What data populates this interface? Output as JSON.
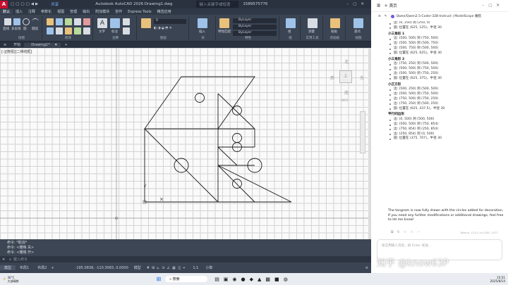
{
  "window": {
    "title": "Autodesk AutoCAD 2026    Drawing1.dwg",
    "share": "共享",
    "search_placeholder": "键入关键字或短语",
    "user": "1589575776"
  },
  "menu": [
    "默认",
    "插入",
    "注释",
    "参数化",
    "视图",
    "管理",
    "输出",
    "附加模块",
    "协作",
    "Express Tools",
    "精选应用"
  ],
  "ribbon": {
    "groups": [
      "绘图",
      "修改",
      "注释",
      "图层",
      "块",
      "特性",
      "组",
      "实用工具",
      "剪贴板",
      "视图"
    ],
    "tools": [
      "直线",
      "多段线",
      "圆",
      "圆弧",
      "文字",
      "标注",
      "插入",
      "特性匹配",
      "组",
      "测量",
      "粘贴",
      "基点"
    ],
    "layer_value": "0",
    "bylayer": [
      "ByLayer",
      "ByLayer",
      "ByLayer"
    ]
  },
  "doc_tabs": [
    "开始",
    "Drawing1*"
  ],
  "viewport_label": "[-][俯视][二维线框]",
  "viewcube": {
    "north": "北",
    "south": "南",
    "west": "西",
    "east": "东",
    "top": "上",
    "wcs": "WCS"
  },
  "ucs": {
    "x": "X",
    "y": "Y"
  },
  "command": {
    "history": [
      "命令: *取消*",
      "命令: <栅格 关>",
      "命令: <栅格 开>"
    ],
    "placeholder": "键入命令"
  },
  "status": {
    "tabs": [
      "模型",
      "布局1",
      "布局2"
    ],
    "coords": "-185.0838, -110.3083, 0.0000",
    "model": "模型",
    "scale": "1:1",
    "decimal": "小数"
  },
  "chat": {
    "nav_home": "首页",
    "model": "Qwen/Qwen2.5-Coder-32B-Instruct | ModelScope 魔搭",
    "lines": [
      {
        "t": "li",
        "s": "边: (0, 250) 到 (250, 0)"
      },
      {
        "t": "li",
        "s": "圆: 位置在 (625, 125)，半径 30"
      },
      {
        "t": "h",
        "s": "小三角形 1"
      },
      {
        "t": "li",
        "s": "边: (500, 500) 到 (750, 500)"
      },
      {
        "t": "li",
        "s": "边: (500, 500) 到 (500, 750)"
      },
      {
        "t": "li",
        "s": "边: (500, 750) 到 (500, 500)"
      },
      {
        "t": "li",
        "s": "圆: 位置在 (625, 625)，半径 30"
      },
      {
        "t": "h",
        "s": "小三角形 2"
      },
      {
        "t": "li",
        "s": "边: (750, 250) 到 (500, 500)"
      },
      {
        "t": "li",
        "s": "边: (500, 500) 到 (750, 500)"
      },
      {
        "t": "li",
        "s": "边: (500, 500) 到 (750, 250)"
      },
      {
        "t": "li",
        "s": "圆: 位置在 (625, 375)，半径 30"
      },
      {
        "t": "h",
        "s": "小正方形"
      },
      {
        "t": "li",
        "s": "边: (500, 250) 到 (500, 500)"
      },
      {
        "t": "li",
        "s": "边: (500, 500) 到 (750, 500)"
      },
      {
        "t": "li",
        "s": "边: (750, 500) 到 (750, 250)"
      },
      {
        "t": "li",
        "s": "边: (750, 250) 到 (500, 250)"
      },
      {
        "t": "li",
        "s": "圆: 位置在 (625, 437.5)，半径 30"
      },
      {
        "t": "h",
        "s": "平行四边形"
      },
      {
        "t": "li",
        "s": "边: (0, 500) 到 (500, 500)"
      },
      {
        "t": "li",
        "s": "边: (500, 500) 到 (750, 854)"
      },
      {
        "t": "li",
        "s": "边: (750, 854) 到 (250, 854)"
      },
      {
        "t": "li",
        "s": "边: (250, 854) 到 (0, 500)"
      },
      {
        "t": "li",
        "s": "圆: 位置在 (375, 707)，半径 30"
      }
    ],
    "final": "The tangram is now fully drawn with the circles added for decoration. If you need any further modifications or additional drawings, feel free to let me know!",
    "tokens": "Tokens: 1213, In:1165, 1077",
    "input_placeholder": "给应用输入消息，按 Enter 发送…",
    "watermark": "知乎 @know63P"
  },
  "taskbar": {
    "search": "搜索",
    "weather_temp": "36°C",
    "weather_desc": "大部晴朗",
    "time": "15:51",
    "date": "2025/8/14"
  }
}
